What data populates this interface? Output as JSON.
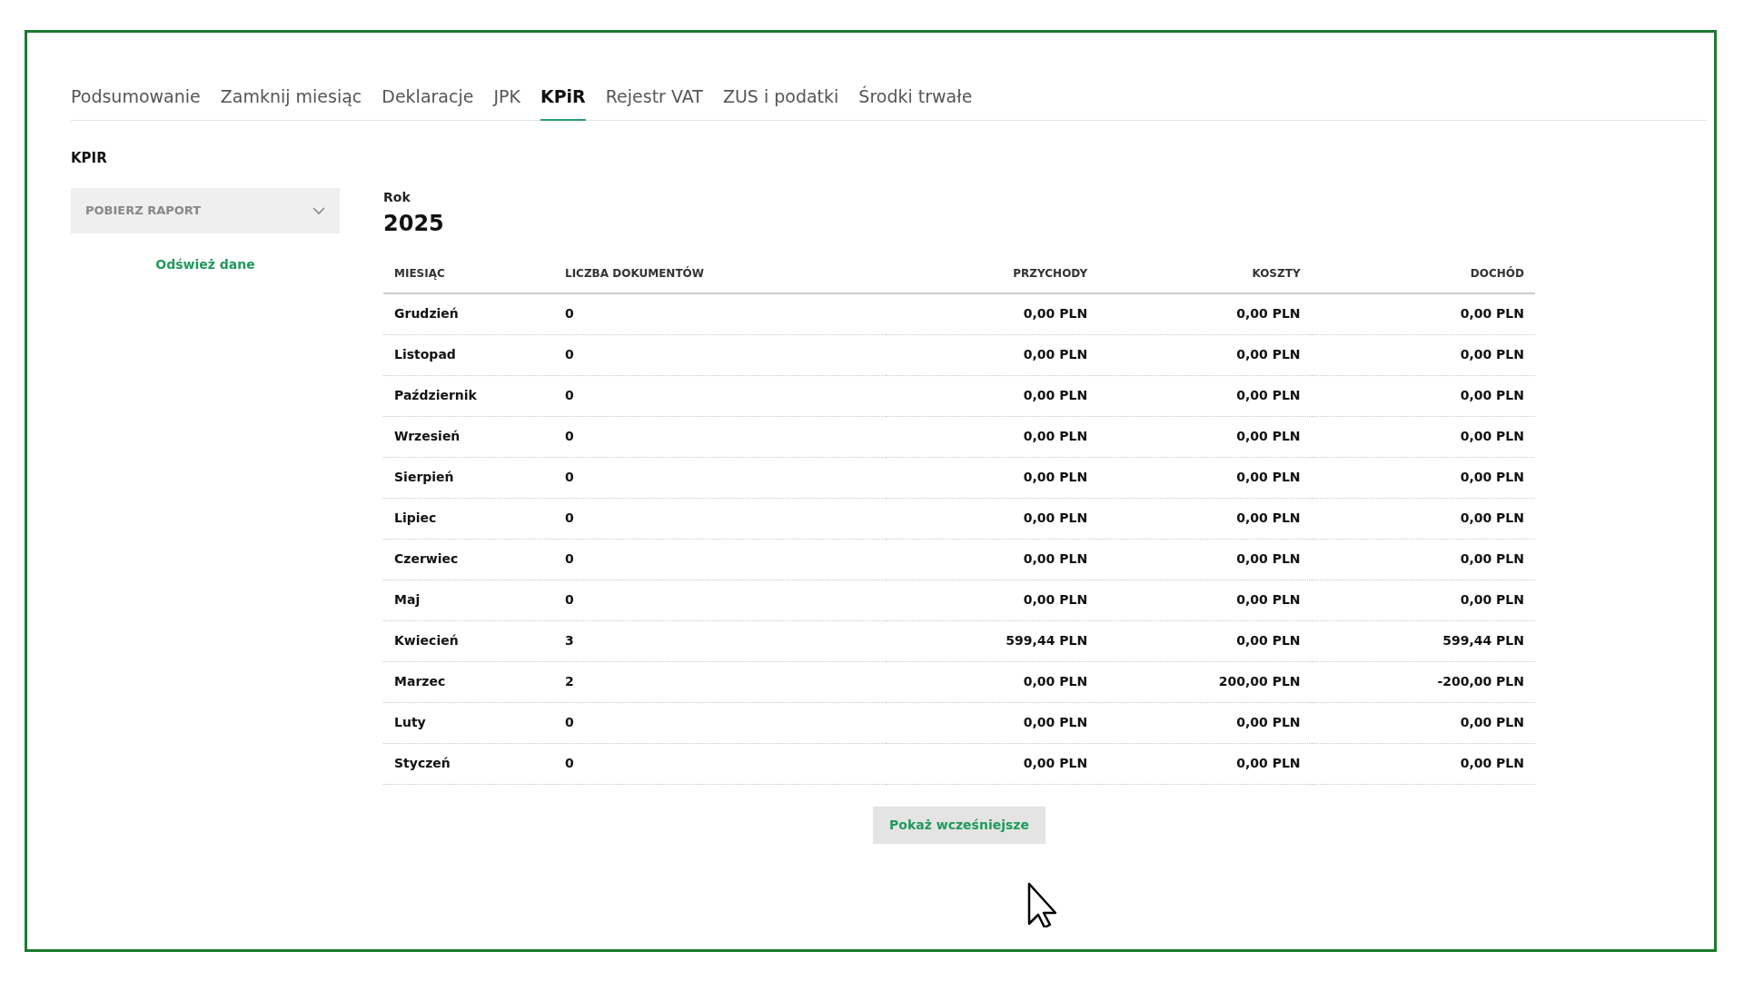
{
  "tabs": [
    {
      "label": "Podsumowanie",
      "selected": false
    },
    {
      "label": "Zamknij miesiąc",
      "selected": false
    },
    {
      "label": "Deklaracje",
      "selected": false
    },
    {
      "label": "JPK",
      "selected": false
    },
    {
      "label": "KPiR",
      "selected": true
    },
    {
      "label": "Rejestr VAT",
      "selected": false
    },
    {
      "label": "ZUS i podatki",
      "selected": false
    },
    {
      "label": "Środki trwałe",
      "selected": false
    }
  ],
  "section_title": "KPIR",
  "report_dropdown": {
    "label": "POBIERZ RAPORT",
    "disabled": true
  },
  "refresh_link": "Odśwież dane",
  "year": {
    "label": "Rok",
    "value": "2025"
  },
  "table": {
    "columns": [
      "MIESIĄC",
      "LICZBA DOKUMENTÓW",
      "PRZYCHODY",
      "KOSZTY",
      "DOCHÓD"
    ],
    "rows": [
      [
        "Grudzień",
        "0",
        "0,00 PLN",
        "0,00 PLN",
        "0,00 PLN"
      ],
      [
        "Listopad",
        "0",
        "0,00 PLN",
        "0,00 PLN",
        "0,00 PLN"
      ],
      [
        "Październik",
        "0",
        "0,00 PLN",
        "0,00 PLN",
        "0,00 PLN"
      ],
      [
        "Wrzesień",
        "0",
        "0,00 PLN",
        "0,00 PLN",
        "0,00 PLN"
      ],
      [
        "Sierpień",
        "0",
        "0,00 PLN",
        "0,00 PLN",
        "0,00 PLN"
      ],
      [
        "Lipiec",
        "0",
        "0,00 PLN",
        "0,00 PLN",
        "0,00 PLN"
      ],
      [
        "Czerwiec",
        "0",
        "0,00 PLN",
        "0,00 PLN",
        "0,00 PLN"
      ],
      [
        "Maj",
        "0",
        "0,00 PLN",
        "0,00 PLN",
        "0,00 PLN"
      ],
      [
        "Kwiecień",
        "3",
        "599,44 PLN",
        "0,00 PLN",
        "599,44 PLN"
      ],
      [
        "Marzec",
        "2",
        "0,00 PLN",
        "200,00 PLN",
        "-200,00 PLN"
      ],
      [
        "Luty",
        "0",
        "0,00 PLN",
        "0,00 PLN",
        "0,00 PLN"
      ],
      [
        "Styczeń",
        "0",
        "0,00 PLN",
        "0,00 PLN",
        "0,00 PLN"
      ]
    ]
  },
  "show_earlier_button": "Pokaż wcześniejsze"
}
